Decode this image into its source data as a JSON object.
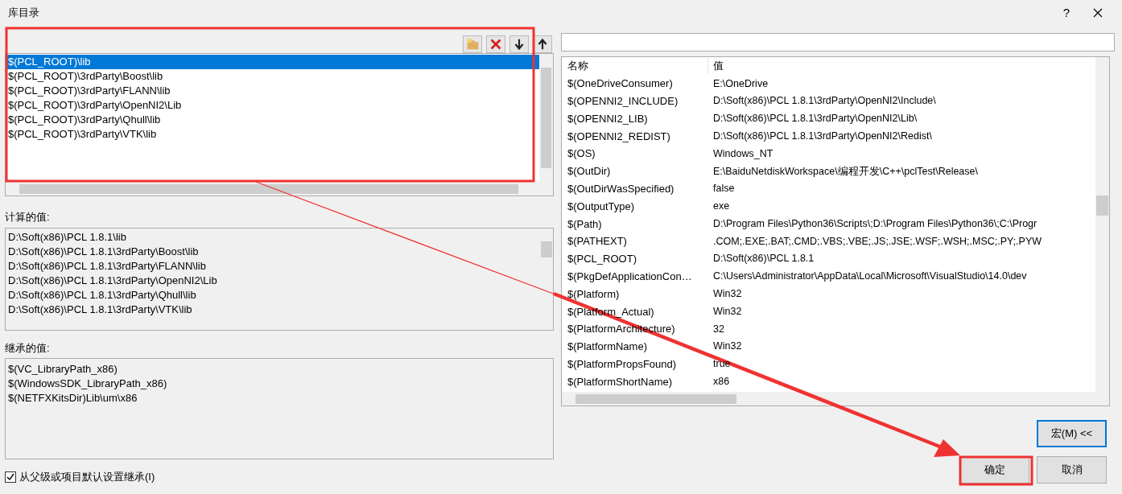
{
  "window": {
    "title": "库目录",
    "help": "?"
  },
  "directories": [
    {
      "text": "$(PCL_ROOT)\\lib",
      "selected": true
    },
    {
      "text": "$(PCL_ROOT)\\3rdParty\\Boost\\lib",
      "selected": false
    },
    {
      "text": "$(PCL_ROOT)\\3rdParty\\FLANN\\lib",
      "selected": false
    },
    {
      "text": "$(PCL_ROOT)\\3rdParty\\OpenNI2\\Lib",
      "selected": false
    },
    {
      "text": "$(PCL_ROOT)\\3rdParty\\Qhull\\lib",
      "selected": false
    },
    {
      "text": "$(PCL_ROOT)\\3rdParty\\VTK\\lib",
      "selected": false
    }
  ],
  "evaluated": {
    "label": "计算的值:",
    "lines": [
      "D:\\Soft(x86)\\PCL 1.8.1\\lib",
      "D:\\Soft(x86)\\PCL 1.8.1\\3rdParty\\Boost\\lib",
      "D:\\Soft(x86)\\PCL 1.8.1\\3rdParty\\FLANN\\lib",
      "D:\\Soft(x86)\\PCL 1.8.1\\3rdParty\\OpenNI2\\Lib",
      "D:\\Soft(x86)\\PCL 1.8.1\\3rdParty\\Qhull\\lib",
      "D:\\Soft(x86)\\PCL 1.8.1\\3rdParty\\VTK\\lib"
    ]
  },
  "inherited": {
    "label": "继承的值:",
    "lines": [
      "$(VC_LibraryPath_x86)",
      "$(WindowsSDK_LibraryPath_x86)",
      "$(NETFXKitsDir)Lib\\um\\x86"
    ]
  },
  "inherit_checkbox": {
    "label": "从父级或项目默认设置继承(I)",
    "checked": true
  },
  "macro_table": {
    "columns": [
      "名称",
      "值"
    ],
    "rows": [
      [
        "$(OneDriveConsumer)",
        "E:\\OneDrive"
      ],
      [
        "$(OPENNI2_INCLUDE)",
        "D:\\Soft(x86)\\PCL 1.8.1\\3rdParty\\OpenNI2\\Include\\"
      ],
      [
        "$(OPENNI2_LIB)",
        "D:\\Soft(x86)\\PCL 1.8.1\\3rdParty\\OpenNI2\\Lib\\"
      ],
      [
        "$(OPENNI2_REDIST)",
        "D:\\Soft(x86)\\PCL 1.8.1\\3rdParty\\OpenNI2\\Redist\\"
      ],
      [
        "$(OS)",
        "Windows_NT"
      ],
      [
        "$(OutDir)",
        "E:\\BaiduNetdiskWorkspace\\编程开发\\C++\\pclTest\\Release\\"
      ],
      [
        "$(OutDirWasSpecified)",
        "false"
      ],
      [
        "$(OutputType)",
        "exe"
      ],
      [
        "$(Path)",
        "D:\\Program Files\\Python36\\Scripts\\;D:\\Program Files\\Python36\\;C:\\Progr"
      ],
      [
        "$(PATHEXT)",
        ".COM;.EXE;.BAT;.CMD;.VBS;.VBE;.JS;.JSE;.WSF;.WSH;.MSC;.PY;.PYW"
      ],
      [
        "$(PCL_ROOT)",
        "D:\\Soft(x86)\\PCL 1.8.1"
      ],
      [
        "$(PkgDefApplicationCon…",
        "C:\\Users\\Administrator\\AppData\\Local\\Microsoft\\VisualStudio\\14.0\\dev"
      ],
      [
        "$(Platform)",
        "Win32"
      ],
      [
        "$(Platform_Actual)",
        "Win32"
      ],
      [
        "$(PlatformArchitecture)",
        "32"
      ],
      [
        "$(PlatformName)",
        "Win32"
      ],
      [
        "$(PlatformPropsFound)",
        "true"
      ],
      [
        "$(PlatformShortName)",
        "x86"
      ]
    ]
  },
  "buttons": [
    {
      "label": "宏(M) <<",
      "focused": true
    },
    {
      "label": "确定",
      "focused": false
    },
    {
      "label": "取消",
      "focused": false
    }
  ]
}
